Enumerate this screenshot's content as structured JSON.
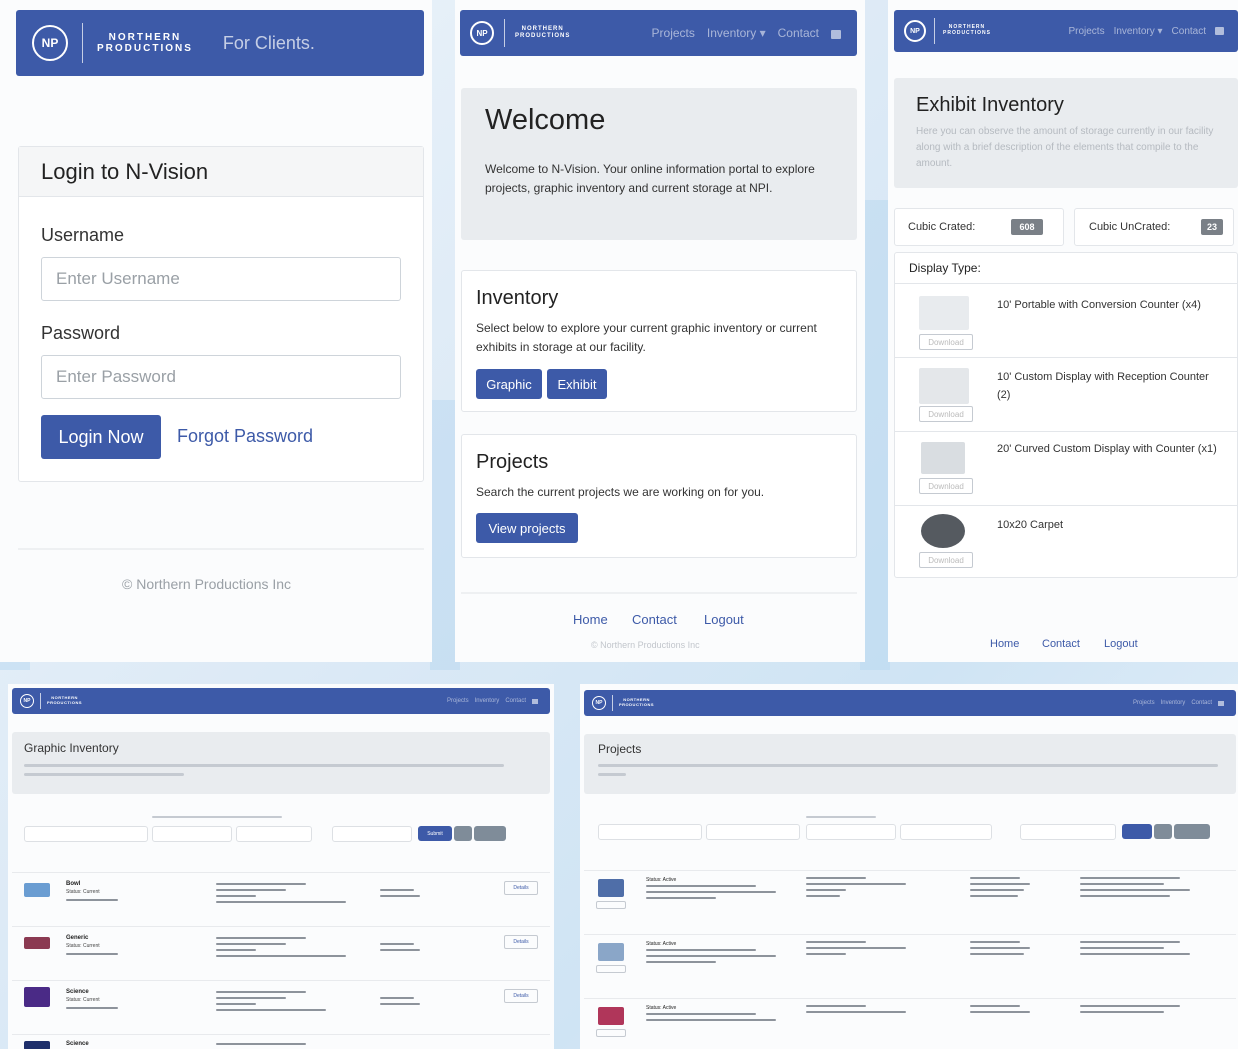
{
  "brand": {
    "line1": "NORTHERN",
    "line2": "PRODUCTIONS",
    "logo_text": "NP"
  },
  "nav": {
    "projects": "Projects",
    "inventory": "Inventory",
    "contact": "Contact",
    "caret": "▾",
    "lock_icon": "lock-icon"
  },
  "login": {
    "header_tagline": "For Clients.",
    "title": "Login to N-Vision",
    "username_label": "Username",
    "username_placeholder": "Enter Username",
    "password_label": "Password",
    "password_placeholder": "Enter Password",
    "login_button": "Login Now",
    "forgot_link": "Forgot Password",
    "footer": "© Northern Productions Inc"
  },
  "welcome": {
    "title": "Welcome",
    "text": "Welcome to N-Vision. Your online information portal to explore projects, graphic inventory and current storage at NPI.",
    "inventory_title": "Inventory",
    "inventory_text": "Select below to explore your current graphic inventory or current exhibits in storage at our facility.",
    "graphic_button": "Graphic",
    "exhibit_button": "Exhibit",
    "projects_title": "Projects",
    "projects_text": "Search the current projects we are working on for you.",
    "view_projects_button": "View projects",
    "footer_home": "Home",
    "footer_contact": "Contact",
    "footer_logout": "Logout",
    "footer_copy": "© Northern Productions Inc"
  },
  "exhibit": {
    "title": "Exhibit Inventory",
    "subtitle": "Here you can observe the amount of storage currently in our facility along with a brief description of the elements that compile to the amount.",
    "cubic_crated_label": "Cubic Crated:",
    "cubic_crated_value": "608",
    "cubic_uncrated_label": "Cubic UnCrated:",
    "cubic_uncrated_value": "23",
    "display_type_label": "Display Type:",
    "download_label": "Download",
    "items": [
      {
        "name": "10' Portable with Conversion Counter (x4)"
      },
      {
        "name": "10' Custom Display with Reception Counter (2)"
      },
      {
        "name": "20' Curved Custom Display with Counter (x1)"
      },
      {
        "name": "10x20 Carpet"
      }
    ],
    "footer_home": "Home",
    "footer_contact": "Contact",
    "footer_logout": "Logout"
  },
  "graphic": {
    "title": "Graphic Inventory",
    "submit": "Submit",
    "rows": [
      {
        "name": "Bowl",
        "status": "Status: Current"
      },
      {
        "name": "Generic",
        "status": "Status: Current"
      },
      {
        "name": "Science",
        "status": "Status: Current"
      },
      {
        "name": "Science",
        "status": ""
      }
    ],
    "details": "Details"
  },
  "projects_page": {
    "title": "Projects",
    "rows": [
      {
        "status": "Status: Active"
      },
      {
        "status": "Status: Active"
      },
      {
        "status": "Status: Active"
      }
    ]
  }
}
